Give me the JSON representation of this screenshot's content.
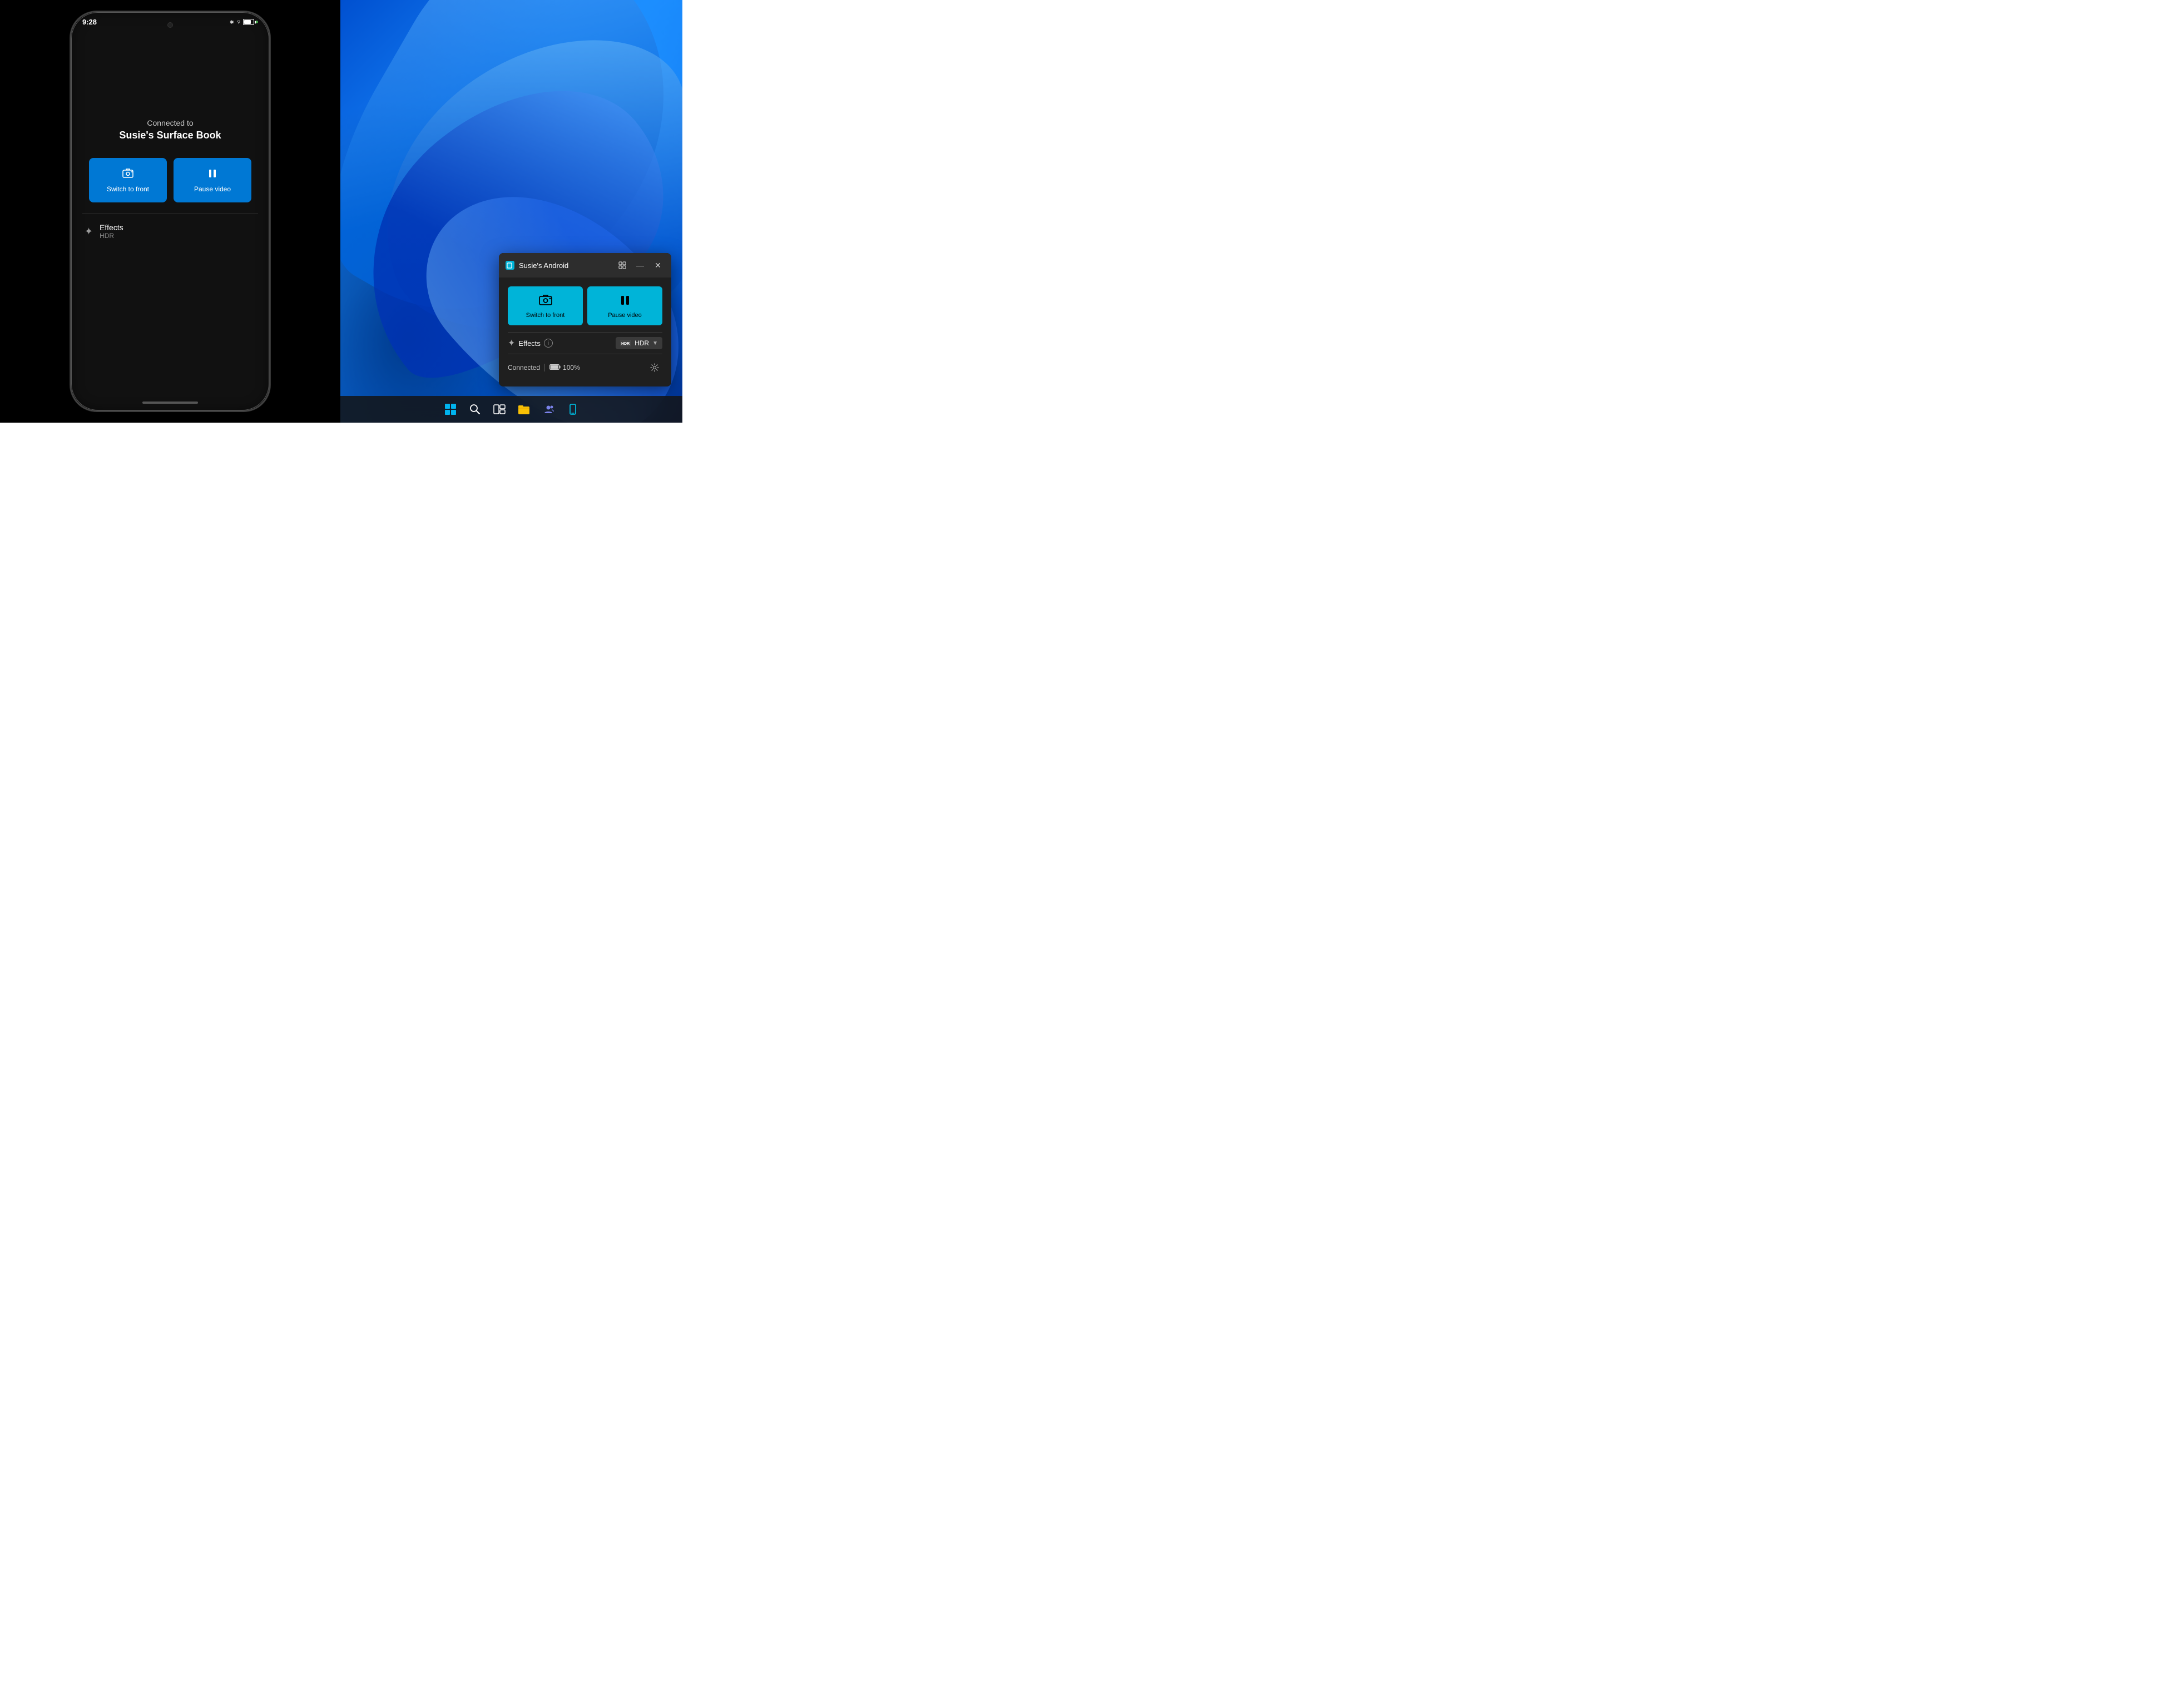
{
  "left_panel": {
    "phone": {
      "time": "9:28",
      "connection_text": "Connected to",
      "device_name": "Susie's Surface Book",
      "buttons": [
        {
          "id": "switch-to-front",
          "icon": "⊡",
          "label": "Switch to front"
        },
        {
          "id": "pause-video",
          "icon": "⏸",
          "label": "Pause video"
        }
      ],
      "effects": {
        "label": "Effects",
        "sublabel": "HDR"
      }
    }
  },
  "right_panel": {
    "wallpaper_alt": "Windows 11 blue flowing wallpaper",
    "floating_window": {
      "title": "Susie's Android",
      "buttons": [
        {
          "id": "switch-to-front",
          "label": "Switch to front"
        },
        {
          "id": "pause-video",
          "label": "Pause video"
        }
      ],
      "effects": {
        "label": "Effects",
        "hdr_option": "HDR"
      },
      "footer": {
        "connected_label": "Connected",
        "battery_level": "100%"
      }
    },
    "taskbar": {
      "items": [
        {
          "id": "start",
          "label": "Start"
        },
        {
          "id": "search",
          "label": "Search"
        },
        {
          "id": "task-view",
          "label": "Task View"
        },
        {
          "id": "file-explorer",
          "label": "File Explorer"
        },
        {
          "id": "teams",
          "label": "Microsoft Teams"
        },
        {
          "id": "phone-link",
          "label": "Phone Link"
        }
      ]
    }
  }
}
